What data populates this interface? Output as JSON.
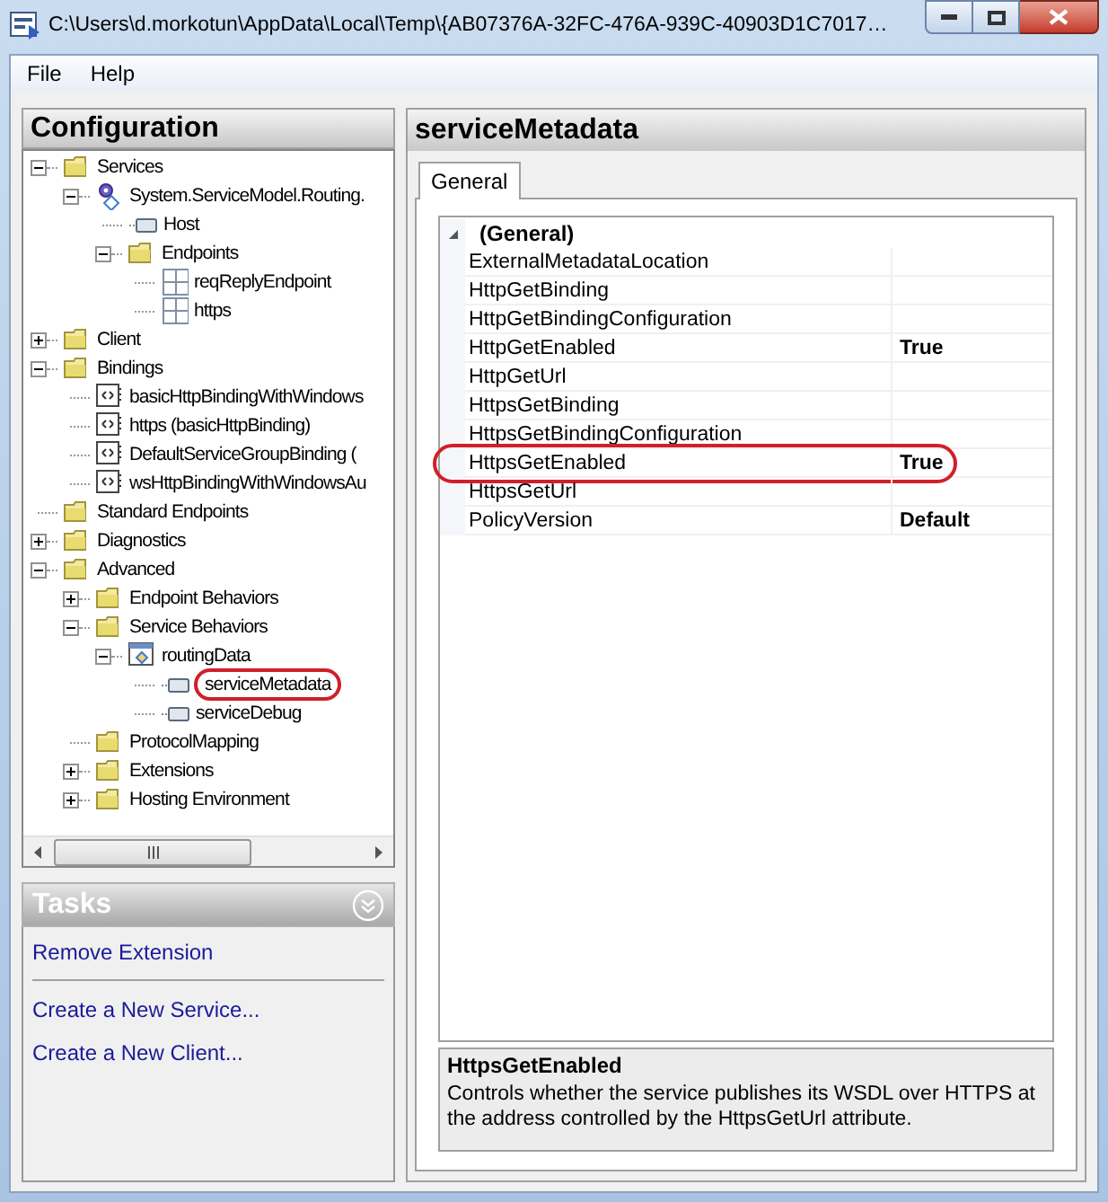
{
  "window": {
    "title": "C:\\Users\\d.morkotun\\AppData\\Local\\Temp\\{AB07376A-32FC-476A-939C-40903D1C7017…"
  },
  "menu": [
    "File",
    "Help"
  ],
  "configuration": {
    "title": "Configuration",
    "tree": [
      {
        "label": "Services",
        "kind": "folder",
        "expanded": true,
        "circled": false,
        "children": [
          {
            "label": "System.ServiceModel.Routing.",
            "kind": "service",
            "expanded": true,
            "circled": false,
            "children": [
              {
                "label": "Host",
                "kind": "element",
                "circled": false
              },
              {
                "label": "Endpoints",
                "kind": "folder",
                "expanded": true,
                "circled": false,
                "children": [
                  {
                    "label": "reqReplyEndpoint",
                    "kind": "endpoint",
                    "circled": false
                  },
                  {
                    "label": "https",
                    "kind": "endpoint",
                    "circled": false
                  }
                ]
              }
            ]
          }
        ]
      },
      {
        "label": "Client",
        "kind": "folder",
        "expanded": false,
        "circled": false
      },
      {
        "label": "Bindings",
        "kind": "folder",
        "expanded": true,
        "circled": false,
        "children": [
          {
            "label": "basicHttpBindingWithWindows",
            "kind": "binding",
            "circled": false
          },
          {
            "label": "https (basicHttpBinding)",
            "kind": "binding",
            "circled": false
          },
          {
            "label": "DefaultServiceGroupBinding (",
            "kind": "binding",
            "circled": false
          },
          {
            "label": "wsHttpBindingWithWindowsAu",
            "kind": "binding",
            "circled": false
          }
        ]
      },
      {
        "label": "Standard Endpoints",
        "kind": "folder",
        "circled": false
      },
      {
        "label": "Diagnostics",
        "kind": "folder",
        "expanded": false,
        "circled": false
      },
      {
        "label": "Advanced",
        "kind": "folder",
        "expanded": true,
        "circled": false,
        "children": [
          {
            "label": "Endpoint Behaviors",
            "kind": "folder",
            "expanded": false,
            "circled": false
          },
          {
            "label": "Service Behaviors",
            "kind": "folder",
            "expanded": true,
            "circled": false,
            "children": [
              {
                "label": "routingData",
                "kind": "behavior",
                "expanded": true,
                "circled": false,
                "children": [
                  {
                    "label": "serviceMetadata",
                    "kind": "element",
                    "circled": true
                  },
                  {
                    "label": "serviceDebug",
                    "kind": "element",
                    "circled": false
                  }
                ]
              }
            ]
          },
          {
            "label": "ProtocolMapping",
            "kind": "folder",
            "circled": false
          },
          {
            "label": "Extensions",
            "kind": "folder",
            "expanded": false,
            "circled": false
          },
          {
            "label": "Hosting Environment",
            "kind": "folder",
            "expanded": false,
            "circled": false
          }
        ]
      }
    ]
  },
  "tasks": {
    "title": "Tasks",
    "items": [
      {
        "label": "Remove Extension",
        "separator_after": true
      },
      {
        "label": "Create a New Service...",
        "separator_after": false
      },
      {
        "label": "Create a New Client...",
        "separator_after": false
      }
    ]
  },
  "details": {
    "title": "serviceMetadata",
    "tabs": [
      {
        "label": "General",
        "selected": true
      }
    ],
    "category": {
      "label": "(General)",
      "expanded": true
    },
    "properties": [
      {
        "name": "ExternalMetadataLocation",
        "circled": false
      },
      {
        "name": "HttpGetBinding",
        "circled": false
      },
      {
        "name": "HttpGetBindingConfiguration",
        "circled": false
      },
      {
        "name": "HttpGetEnabled",
        "value": "True",
        "circled": false
      },
      {
        "name": "HttpGetUrl",
        "circled": false
      },
      {
        "name": "HttpsGetBinding",
        "circled": false
      },
      {
        "name": "HttpsGetBindingConfiguration",
        "circled": false
      },
      {
        "name": "HttpsGetEnabled",
        "value": "True",
        "circled": true
      },
      {
        "name": "HttpsGetUrl",
        "circled": false
      },
      {
        "name": "PolicyVersion",
        "value": "Default",
        "circled": false
      }
    ],
    "description": {
      "title": "HttpsGetEnabled",
      "text": "Controls whether the service publishes its WSDL over HTTPS at the address controlled by the HttpsGetUrl attribute."
    }
  }
}
